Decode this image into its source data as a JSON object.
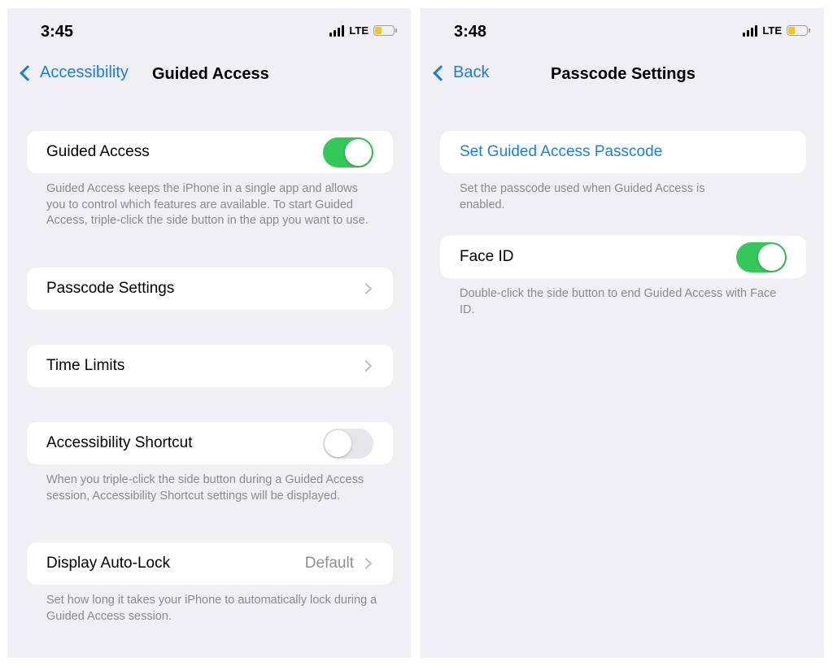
{
  "left_screen": {
    "status": {
      "time": "3:45",
      "network": "LTE"
    },
    "nav": {
      "back_label": "Accessibility",
      "title": "Guided Access"
    },
    "guided_access": {
      "label": "Guided Access",
      "toggle_on": true,
      "footnote": "Guided Access keeps the iPhone in a single app and allows you to control which features are available. To start Guided Access, triple-click the side button in the app you want to use."
    },
    "passcode_settings": {
      "label": "Passcode Settings"
    },
    "time_limits": {
      "label": "Time Limits"
    },
    "accessibility_shortcut": {
      "label": "Accessibility Shortcut",
      "toggle_on": false,
      "footnote": "When you triple-click the side button during a Guided Access session, Accessibility Shortcut settings will be displayed."
    },
    "display_auto_lock": {
      "label": "Display Auto-Lock",
      "value": "Default",
      "footnote": "Set how long it takes your iPhone to automatically lock during a Guided Access session."
    }
  },
  "right_screen": {
    "status": {
      "time": "3:48",
      "network": "LTE"
    },
    "nav": {
      "back_label": "Back",
      "title": "Passcode Settings"
    },
    "set_passcode": {
      "label": "Set Guided Access Passcode",
      "footnote": "Set the passcode used when Guided Access is enabled."
    },
    "face_id": {
      "label": "Face ID",
      "toggle_on": true,
      "footnote": "Double-click the side button to end Guided Access with Face ID."
    }
  },
  "colors": {
    "accent_blue": "#1a7fd9",
    "toggle_on_green": "#34c759",
    "grouped_background": "#efeff4",
    "battery_yellow": "#f5c518"
  },
  "icons": [
    "signal-icon",
    "battery-icon",
    "chevron-left-icon",
    "chevron-right-icon"
  ]
}
